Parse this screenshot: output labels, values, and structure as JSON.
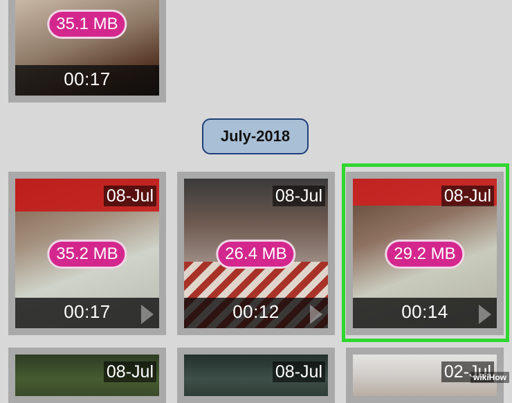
{
  "month_header": "July-2018",
  "videos": [
    {
      "size": "35.1 MB",
      "duration": "00:17"
    },
    {
      "date": "08-Jul",
      "size": "35.2 MB",
      "duration": "00:17"
    },
    {
      "date": "08-Jul",
      "size": "26.4 MB",
      "duration": "00:12"
    },
    {
      "date": "08-Jul",
      "size": "29.2 MB",
      "duration": "00:14"
    },
    {
      "date": "08-Jul"
    },
    {
      "date": "08-Jul"
    },
    {
      "date": "02-Jul"
    }
  ],
  "watermark": "wikiHow"
}
